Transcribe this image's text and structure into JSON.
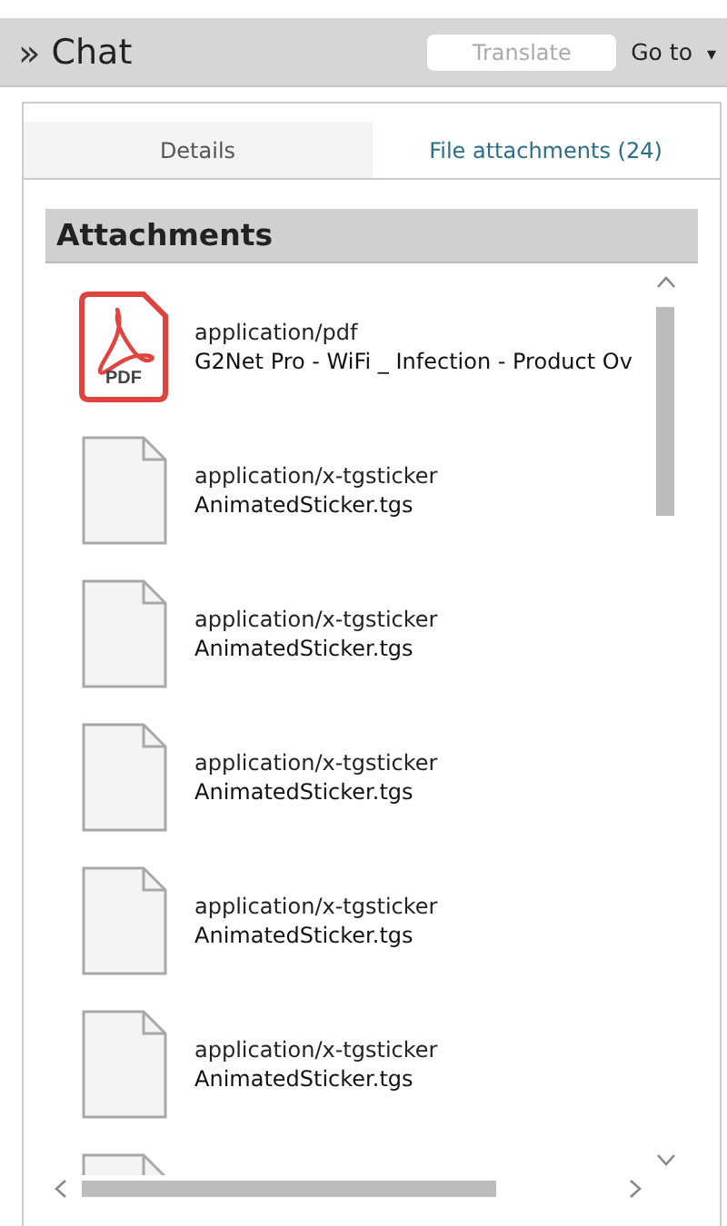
{
  "header": {
    "toggle": "»",
    "title": "Chat",
    "translate_placeholder": "Translate",
    "goto": "Go to",
    "goto_caret": "▾"
  },
  "tabs": [
    {
      "label": "Details",
      "selected": false
    },
    {
      "label": "File attachments (24)",
      "selected": true
    }
  ],
  "attachments": {
    "title": "Attachments",
    "items": [
      {
        "kind": "pdf",
        "badge": "PDF",
        "mime": "application/pdf",
        "name": "G2Net Pro - WiFi _ Infection - Product Ov"
      },
      {
        "kind": "file",
        "mime": "application/x-tgsticker",
        "name": "AnimatedSticker.tgs"
      },
      {
        "kind": "file",
        "mime": "application/x-tgsticker",
        "name": "AnimatedSticker.tgs"
      },
      {
        "kind": "file",
        "mime": "application/x-tgsticker",
        "name": "AnimatedSticker.tgs"
      },
      {
        "kind": "file",
        "mime": "application/x-tgsticker",
        "name": "AnimatedSticker.tgs"
      },
      {
        "kind": "file",
        "mime": "application/x-tgsticker",
        "name": "AnimatedSticker.tgs"
      },
      {
        "kind": "file"
      }
    ]
  }
}
